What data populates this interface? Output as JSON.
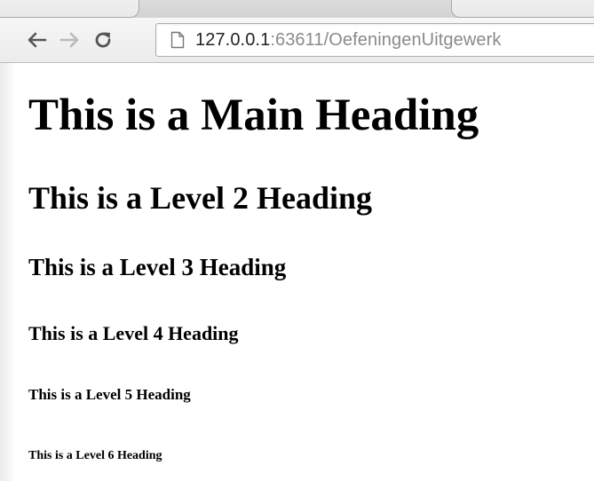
{
  "browser": {
    "address_host": "127.0.0.1",
    "address_rest": ":63611/OefeningenUitgewerk",
    "icons": {
      "back": "back-arrow-icon",
      "forward": "forward-arrow-icon",
      "reload": "reload-icon",
      "page": "page-icon"
    }
  },
  "page": {
    "h1": "This is a Main Heading",
    "h2": "This is a Level 2 Heading",
    "h3": "This is a Level 3 Heading",
    "h4": "This is a Level 4 Heading",
    "h5": "This is a Level 5 Heading",
    "h6": "This is a Level 6 Heading"
  }
}
